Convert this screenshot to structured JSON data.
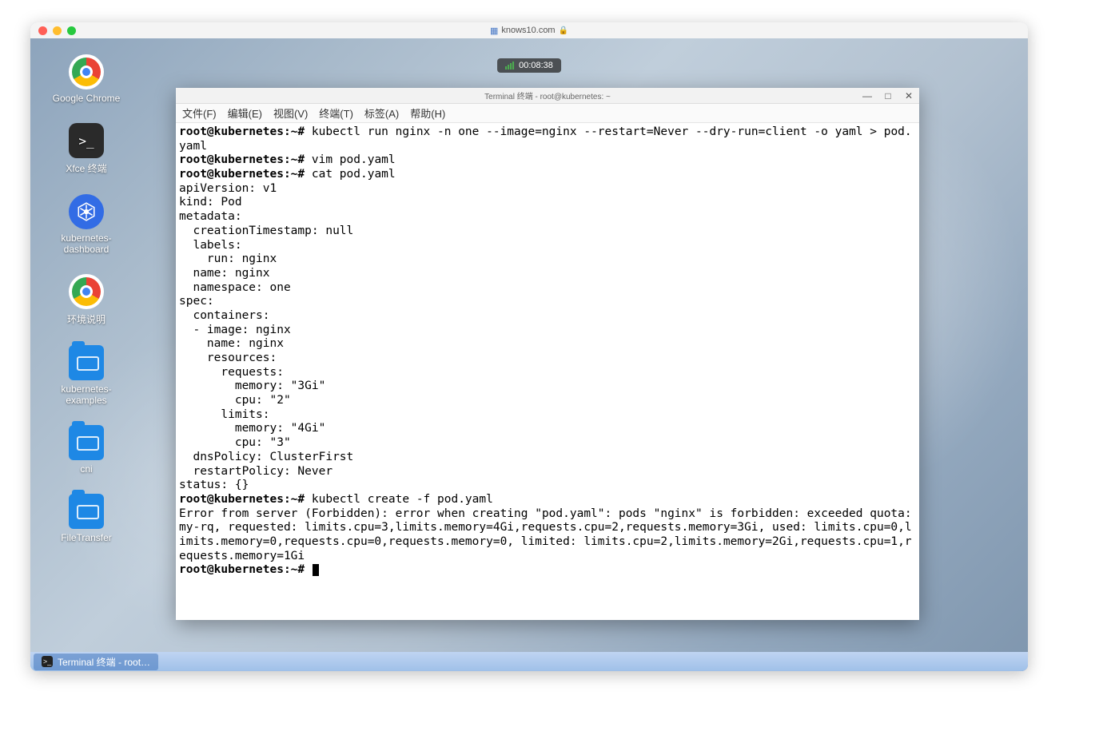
{
  "mac": {
    "url": "knows10.com",
    "timer": "00:08:38"
  },
  "desktop_icons": [
    {
      "id": "chrome",
      "label": "Google Chrome",
      "icon": "chrome"
    },
    {
      "id": "xfce-term",
      "label": "Xfce 终端",
      "icon": "term"
    },
    {
      "id": "k8s-dash",
      "label": "kubernetes-dashboard",
      "icon": "k8s"
    },
    {
      "id": "env",
      "label": "环境说明",
      "icon": "chrome"
    },
    {
      "id": "k8s-ex",
      "label": "kubernetes-examples",
      "icon": "folder"
    },
    {
      "id": "cni",
      "label": "cni",
      "icon": "folder"
    },
    {
      "id": "filetrans",
      "label": "FileTransfer",
      "icon": "folder"
    }
  ],
  "terminal": {
    "title": "Terminal 终端 - root@kubernetes: ~",
    "menu": [
      "文件(F)",
      "编辑(E)",
      "视图(V)",
      "终端(T)",
      "标签(A)",
      "帮助(H)"
    ],
    "window_controls": {
      "min": "—",
      "max": "□",
      "close": "✕"
    },
    "prompt": "root@kubernetes:~#",
    "lines": [
      {
        "sep": false,
        "prompt": true,
        "t": "kubectl run nginx -n one --image=nginx --restart=Never --dry-run=client -o yaml > pod.yaml"
      },
      {
        "sep": false,
        "prompt": true,
        "t": "vim pod.yaml"
      },
      {
        "sep": false,
        "prompt": true,
        "t": "cat pod.yaml"
      },
      {
        "sep": false,
        "prompt": false,
        "t": "apiVersion: v1"
      },
      {
        "sep": false,
        "prompt": false,
        "t": "kind: Pod"
      },
      {
        "sep": false,
        "prompt": false,
        "t": "metadata:"
      },
      {
        "sep": false,
        "prompt": false,
        "t": "  creationTimestamp: null"
      },
      {
        "sep": false,
        "prompt": false,
        "t": "  labels:"
      },
      {
        "sep": false,
        "prompt": false,
        "t": "    run: nginx"
      },
      {
        "sep": false,
        "prompt": false,
        "t": "  name: nginx"
      },
      {
        "sep": false,
        "prompt": false,
        "t": "  namespace: one"
      },
      {
        "sep": false,
        "prompt": false,
        "t": "spec:"
      },
      {
        "sep": false,
        "prompt": false,
        "t": "  containers:"
      },
      {
        "sep": false,
        "prompt": false,
        "t": "  - image: nginx"
      },
      {
        "sep": false,
        "prompt": false,
        "t": "    name: nginx"
      },
      {
        "sep": false,
        "prompt": false,
        "t": "    resources:"
      },
      {
        "sep": false,
        "prompt": false,
        "t": "      requests:"
      },
      {
        "sep": false,
        "prompt": false,
        "t": "        memory: \"3Gi\""
      },
      {
        "sep": false,
        "prompt": false,
        "t": "        cpu: \"2\""
      },
      {
        "sep": false,
        "prompt": false,
        "t": "      limits:"
      },
      {
        "sep": false,
        "prompt": false,
        "t": "        memory: \"4Gi\""
      },
      {
        "sep": false,
        "prompt": false,
        "t": "        cpu: \"3\""
      },
      {
        "sep": false,
        "prompt": false,
        "t": "  dnsPolicy: ClusterFirst"
      },
      {
        "sep": false,
        "prompt": false,
        "t": "  restartPolicy: Never"
      },
      {
        "sep": false,
        "prompt": false,
        "t": "status: {}"
      },
      {
        "sep": false,
        "prompt": true,
        "t": "kubectl create -f pod.yaml"
      },
      {
        "sep": false,
        "prompt": false,
        "t": "Error from server (Forbidden): error when creating \"pod.yaml\": pods \"nginx\" is forbidden: exceeded quota: my-rq, requested: limits.cpu=3,limits.memory=4Gi,requests.cpu=2,requests.memory=3Gi, used: limits.cpu=0,limits.memory=0,requests.cpu=0,requests.memory=0, limited: limits.cpu=2,limits.memory=2Gi,requests.cpu=1,requests.memory=1Gi"
      },
      {
        "sep": false,
        "prompt": true,
        "t": "",
        "cursor": true
      }
    ]
  },
  "taskbar": {
    "item": "Terminal 终端 - root…"
  }
}
